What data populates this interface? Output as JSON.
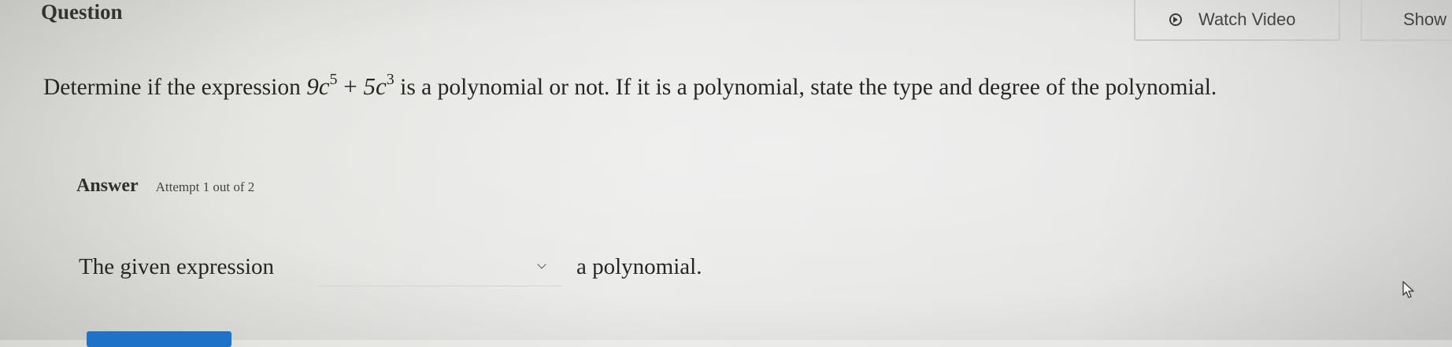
{
  "header": {
    "question_label": "Question",
    "watch_video_label": "Watch Video",
    "show_examples_label": "Show E"
  },
  "question": {
    "prompt_before": "Determine if the expression ",
    "term1_base": "9c",
    "term1_exp": "5",
    "operator": " + ",
    "term2_base": "5c",
    "term2_exp": "3",
    "prompt_after": " is a polynomial or not. If it is a polynomial, state the type and degree of the polynomial."
  },
  "answer": {
    "label": "Answer",
    "attempt_text": "Attempt 1 out of 2",
    "sentence_start": "The given expression",
    "dropdown_value": "",
    "sentence_end": "a polynomial."
  },
  "icons": {
    "play": "play-circle-icon",
    "chevron": "chevron-down-icon",
    "cursor": "mouse-pointer-icon"
  },
  "colors": {
    "accent": "#1e73c8"
  }
}
